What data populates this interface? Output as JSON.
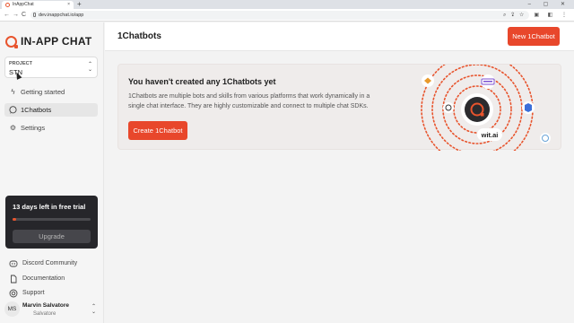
{
  "browser": {
    "tab_title": "InAppChat",
    "tab_close": "×",
    "new_tab": "+",
    "window_controls": "– ▢ ✕",
    "url": "dev.inappchat.io/app",
    "nav_back": "←",
    "nav_forward": "→",
    "nav_reload": "C"
  },
  "sidebar": {
    "logo_text": "IN-APP CHAT",
    "project_label": "PROJECT",
    "project_value": "STN",
    "nav": [
      {
        "label": "Getting started",
        "icon": "lightning-icon"
      },
      {
        "label": "1Chatbots",
        "icon": "chat-bubble-icon"
      },
      {
        "label": "Settings",
        "icon": "gear-icon"
      }
    ],
    "trial": {
      "text": "13 days left in free trial",
      "progress": 0.05,
      "button": "Upgrade"
    },
    "footer": [
      {
        "label": "Discord Community",
        "icon": "discord-icon"
      },
      {
        "label": "Documentation",
        "icon": "document-icon"
      },
      {
        "label": "Support",
        "icon": "support-icon"
      }
    ],
    "user": {
      "initials": "MS",
      "name": "Marvin Salvatore",
      "subtitle": "Salvatore"
    }
  },
  "main": {
    "title": "1Chatbots",
    "new_button": "New 1Chatbot",
    "empty_state": {
      "title": "You haven't created any 1Chatbots yet",
      "description": "1Chatbots are multiple bots and skills from various platforms that work dynamically in a single chat interface. They are highly customizable and connect to multiple chat SDKs.",
      "button": "Create 1Chatbot",
      "integration_label": "wit.ai"
    }
  },
  "colors": {
    "accent": "#e8472b",
    "trial_bg": "#26262a"
  }
}
